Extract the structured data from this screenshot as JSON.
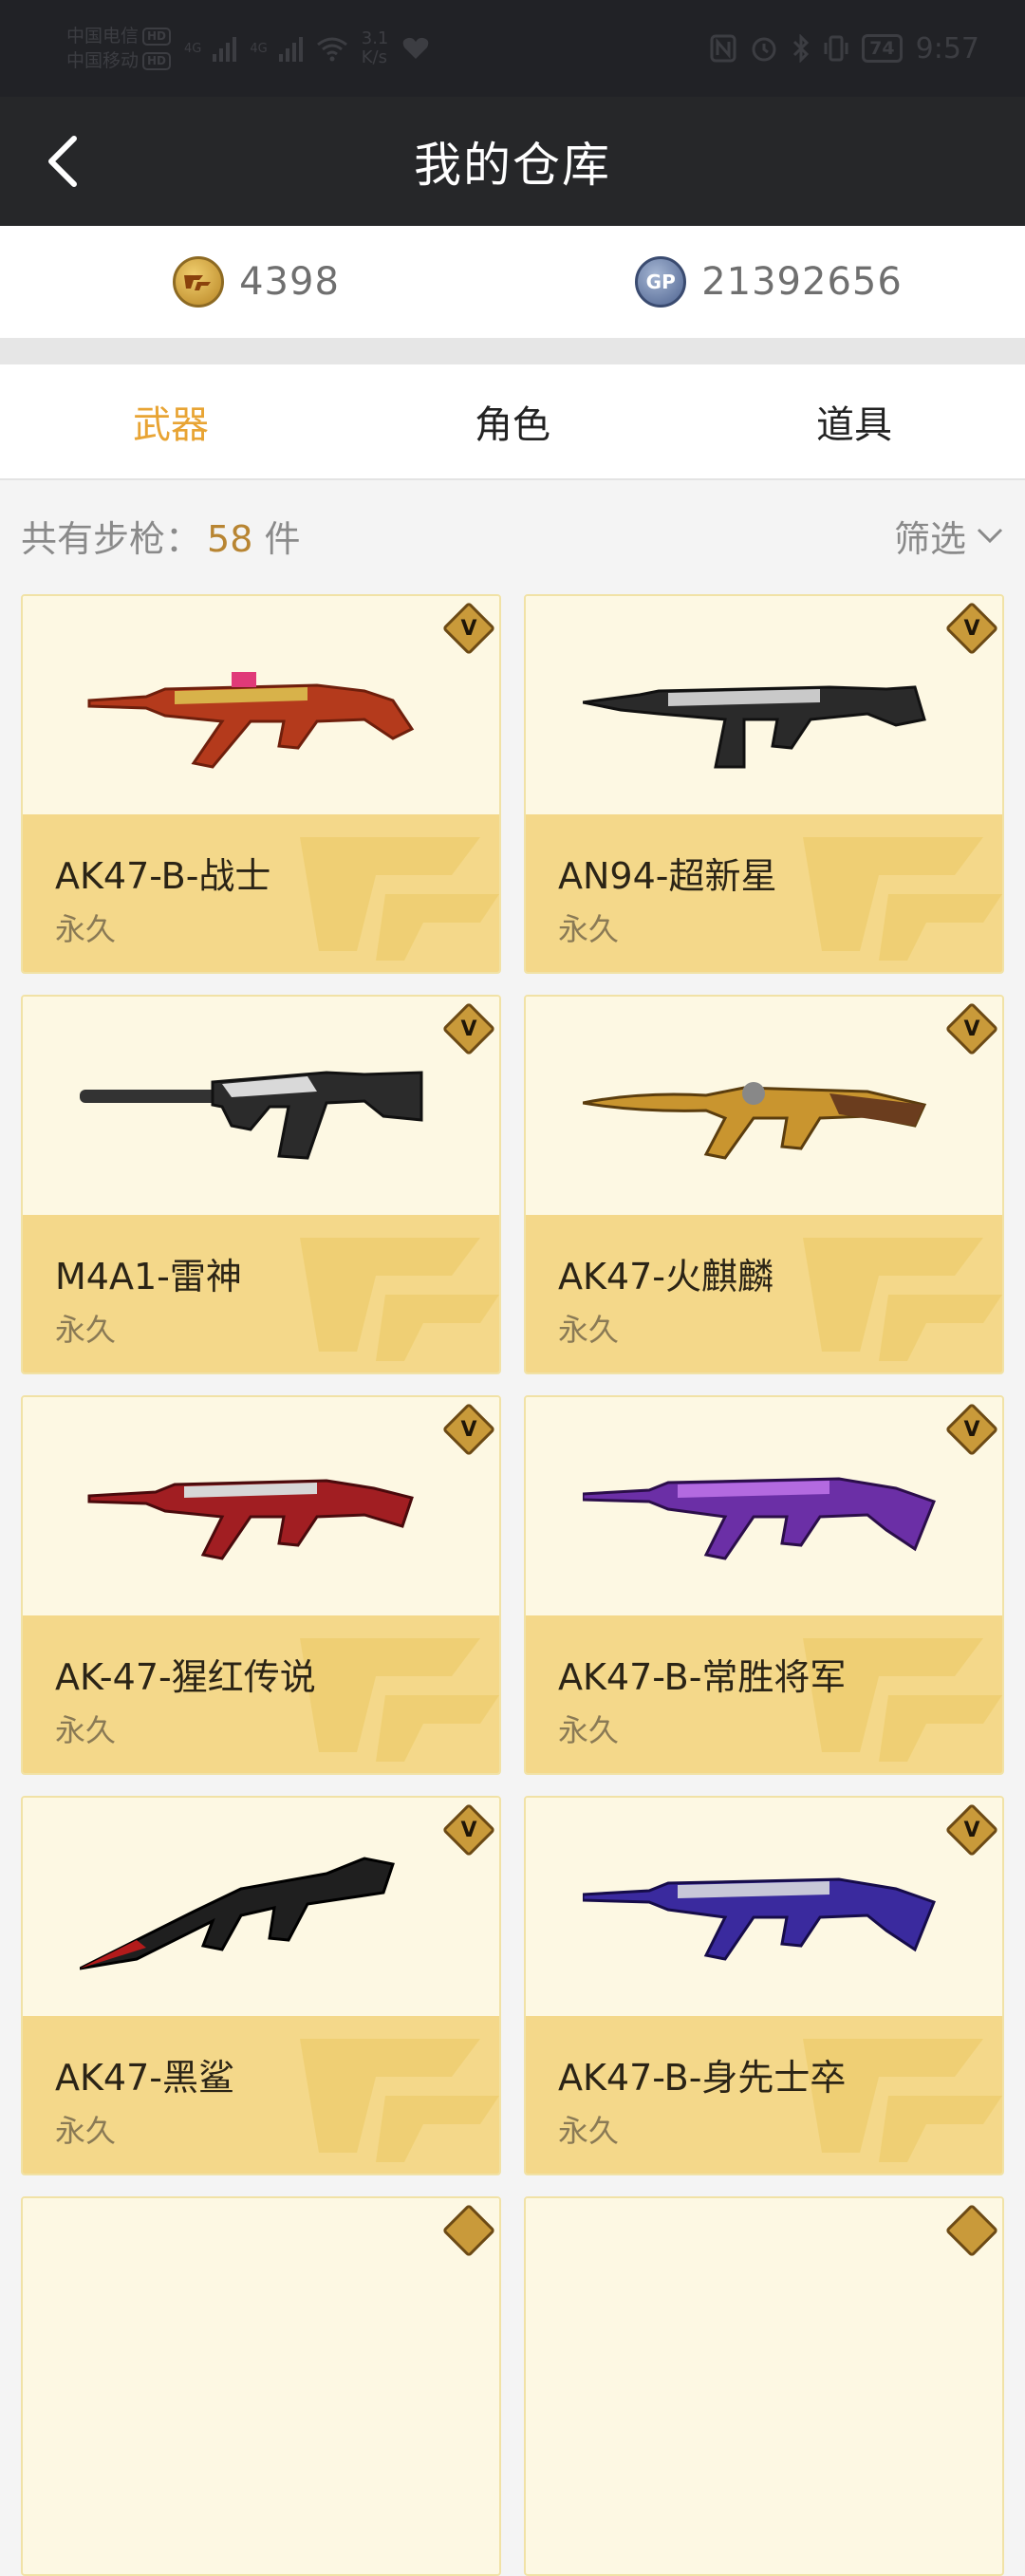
{
  "status_bar": {
    "carrier1": "中国电信",
    "carrier2": "中国移动",
    "hd": "HD",
    "network": "4G",
    "speed_value": "3.1",
    "speed_unit": "K/s",
    "battery": "74",
    "time": "9:57"
  },
  "header": {
    "title": "我的仓库",
    "back_icon": "chevron-left-icon"
  },
  "currency": {
    "cf_points": "4398",
    "gp_points": "21392656",
    "gp_label": "GP"
  },
  "tabs": [
    {
      "label": "武器",
      "active": true
    },
    {
      "label": "角色",
      "active": false
    },
    {
      "label": "道具",
      "active": false
    }
  ],
  "summary": {
    "prefix": "共有步枪：",
    "count": "58",
    "suffix": " 件",
    "filter_label": "筛选"
  },
  "colors": {
    "accent": "#e8a434",
    "card_top": "#fdf8e3",
    "card_bottom": "#f4d88a"
  },
  "items": [
    {
      "name": "AK47-B-战士",
      "duration": "永久",
      "badge": "V"
    },
    {
      "name": "AN94-超新星",
      "duration": "永久",
      "badge": "V"
    },
    {
      "name": "M4A1-雷神",
      "duration": "永久",
      "badge": "V"
    },
    {
      "name": "AK47-火麒麟",
      "duration": "永久",
      "badge": "V"
    },
    {
      "name": "AK-47-猩红传说",
      "duration": "永久",
      "badge": "V"
    },
    {
      "name": "AK47-B-常胜将军",
      "duration": "永久",
      "badge": "V"
    },
    {
      "name": "AK47-黑鲨",
      "duration": "永久",
      "badge": "V"
    },
    {
      "name": "AK47-B-身先士卒",
      "duration": "永久",
      "badge": "V"
    }
  ]
}
